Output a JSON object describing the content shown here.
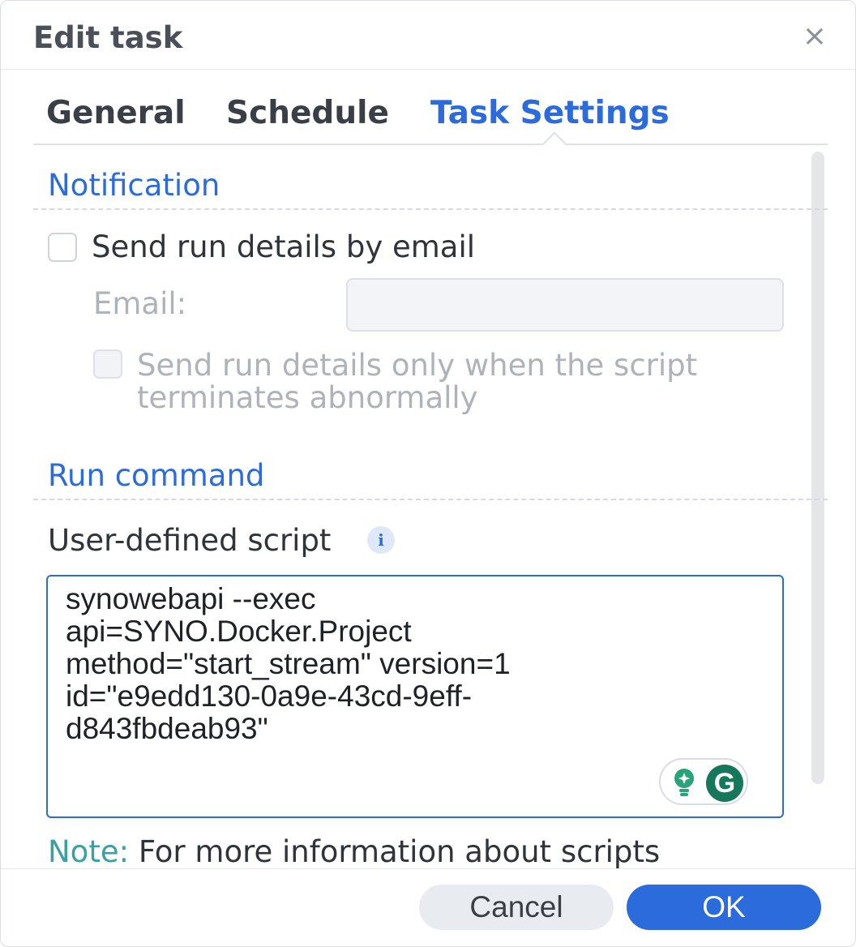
{
  "dialog": {
    "title": "Edit task",
    "close_glyph": "×"
  },
  "tabs": [
    {
      "label": "General",
      "active": false
    },
    {
      "label": "Schedule",
      "active": false
    },
    {
      "label": "Task Settings",
      "active": true
    }
  ],
  "notification": {
    "section_title": "Notification",
    "send_email_label": "Send run details by email",
    "send_email_checked": false,
    "email_label": "Email:",
    "email_value": "",
    "abnormal_label_line1": "Send run details only when the script",
    "abnormal_label_line2": "terminates abnormally",
    "abnormal_checked": false
  },
  "run_command": {
    "section_title": "Run command",
    "script_label": "User-defined script",
    "info_glyph": "i",
    "script": "synowebapi --exec\napi=SYNO.Docker.Project\nmethod=\"start_stream\" version=1\nid=\"e9edd130-0a9e-43cd-9eff-\nd843fbdeab93\"",
    "grammarly_glyph": "G"
  },
  "note": {
    "label": "Note:",
    "text": " For more information about scripts"
  },
  "footer": {
    "cancel_label": "Cancel",
    "ok_label": "OK"
  },
  "colors": {
    "accent": "#2c6bdc",
    "grammarly": "#15785c",
    "note_label": "#3aa0a0"
  },
  "icons": [
    "close-icon",
    "info-icon",
    "grammarly-bulb-icon",
    "grammarly-icon"
  ]
}
